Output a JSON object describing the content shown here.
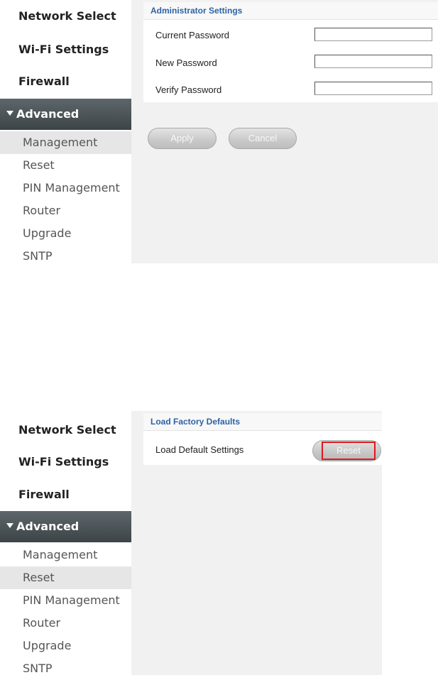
{
  "top_panel": {
    "sidebar": {
      "items": [
        "Network Select",
        "Wi-Fi Settings",
        "Firewall"
      ],
      "advanced_label": "Advanced",
      "sub_items": [
        "Management",
        "Reset",
        "PIN Management",
        "Router",
        "Upgrade",
        "SNTP"
      ],
      "active_sub_item": "Management"
    },
    "section_title": "Administrator Settings",
    "fields": [
      {
        "label": "Current Password",
        "value": ""
      },
      {
        "label": "New Password",
        "value": ""
      },
      {
        "label": "Verify Password",
        "value": ""
      }
    ],
    "buttons": {
      "apply": "Apply",
      "cancel": "Cancel"
    }
  },
  "bottom_panel": {
    "sidebar": {
      "items": [
        "Network Select",
        "Wi-Fi Settings",
        "Firewall"
      ],
      "advanced_label": "Advanced",
      "sub_items": [
        "Management",
        "Reset",
        "PIN Management",
        "Router",
        "Upgrade",
        "SNTP"
      ],
      "active_sub_item": "Reset"
    },
    "section_title": "Load Factory Defaults",
    "row_label": "Load Default Settings",
    "reset_button": "Reset",
    "highlight_color": "#e2161d"
  },
  "colors": {
    "section_title": "#2e62a6",
    "advanced_header": "#4a5357",
    "content_bg": "#f1f1f1"
  }
}
